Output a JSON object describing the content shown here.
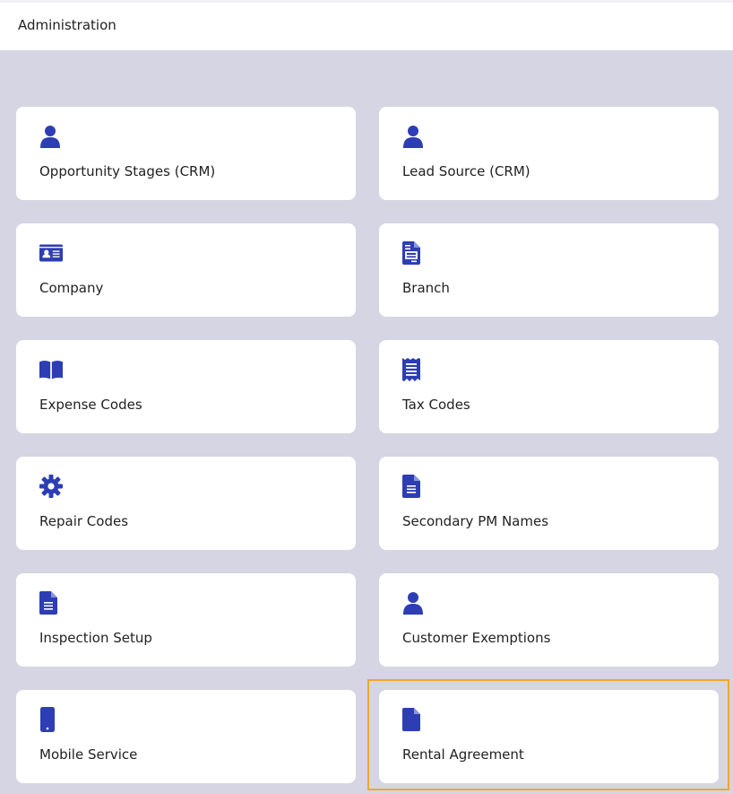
{
  "header": {
    "title": "Administration"
  },
  "accent_color": "#2d3db3",
  "highlight_color": "#f5a623",
  "cards": [
    {
      "label": "Opportunity Stages (CRM)",
      "icon": "user-icon"
    },
    {
      "label": "Lead Source (CRM)",
      "icon": "user-icon"
    },
    {
      "label": "Company",
      "icon": "id-card-icon"
    },
    {
      "label": "Branch",
      "icon": "file-invoice-icon"
    },
    {
      "label": "Expense Codes",
      "icon": "open-book-icon"
    },
    {
      "label": "Tax Codes",
      "icon": "receipt-icon"
    },
    {
      "label": "Repair Codes",
      "icon": "gear-icon"
    },
    {
      "label": "Secondary PM Names",
      "icon": "document-lines-icon"
    },
    {
      "label": "Inspection Setup",
      "icon": "document-lines-icon"
    },
    {
      "label": "Customer Exemptions",
      "icon": "user-icon"
    },
    {
      "label": "Mobile Service",
      "icon": "mobile-phone-icon"
    },
    {
      "label": "Rental Agreement",
      "icon": "file-icon",
      "highlighted": true
    }
  ]
}
